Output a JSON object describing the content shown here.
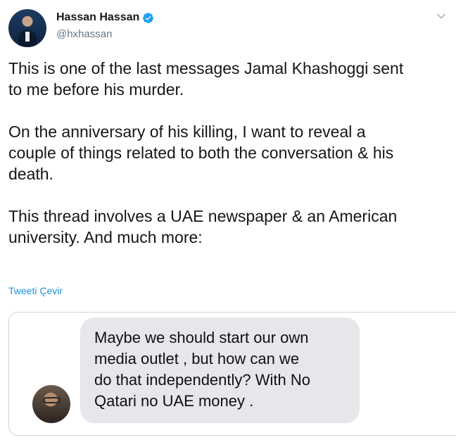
{
  "author": {
    "display_name": "Hassan Hassan",
    "handle": "@hxhassan",
    "verified_icon": "verified-badge-icon",
    "verified_color": "#1da1f2"
  },
  "tweet": {
    "text": "This is one of the last messages Jamal Khashoggi sent\nto me before his murder.\n\nOn the anniversary of his killing, I want to reveal a\ncouple of things related to both the conversation & his\ndeath.\n\nThis thread involves a UAE newspaper & an American\nuniversity. And much more:",
    "translate_label": "Tweeti Çevir"
  },
  "attached_image": {
    "message_text": "Maybe we should start our own\nmedia outlet , but how can we\ndo that independently? With No\nQatari no UAE money ."
  },
  "colors": {
    "link": "#1b95e0",
    "handle": "#657786",
    "bubble": "#e6e6eb"
  }
}
